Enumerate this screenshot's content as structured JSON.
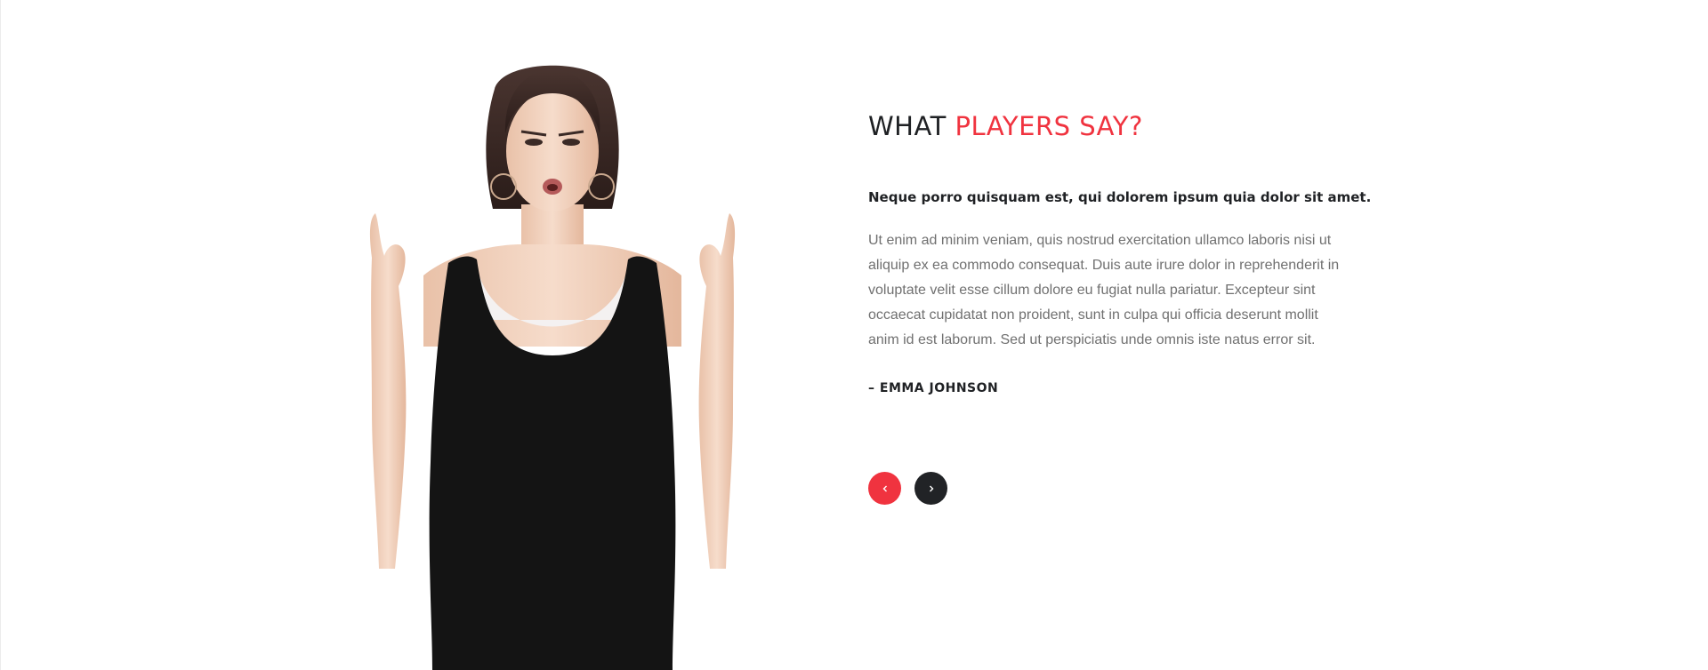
{
  "testimonial": {
    "heading_part1": "WHAT",
    "heading_part2": "PLAYERS SAY?",
    "lead": "Neque porro quisquam est, qui dolorem ipsum quia dolor sit amet.",
    "body": "Ut enim ad minim veniam, quis nostrud exercitation ullamco laboris nisi ut aliquip ex ea commodo consequat. Duis aute irure dolor in reprehenderit in voluptate velit esse cillum dolore eu fugiat nulla pariatur. Excepteur sint occaecat cupidatat non proident, sunt in culpa qui officia deserunt mollit anim id est laborum. Sed ut perspiciatis unde omnis iste natus error sit.",
    "author": "– EMMA JOHNSON"
  },
  "carousel": {
    "prev_icon": "chevron-left-icon",
    "next_icon": "chevron-right-icon"
  },
  "colors": {
    "accent": "#f0333f",
    "dark": "#212326",
    "body_text": "#707070",
    "heading": "#1f2124"
  },
  "photo": {
    "subject": "woman-making-rock-gesture-icon"
  }
}
